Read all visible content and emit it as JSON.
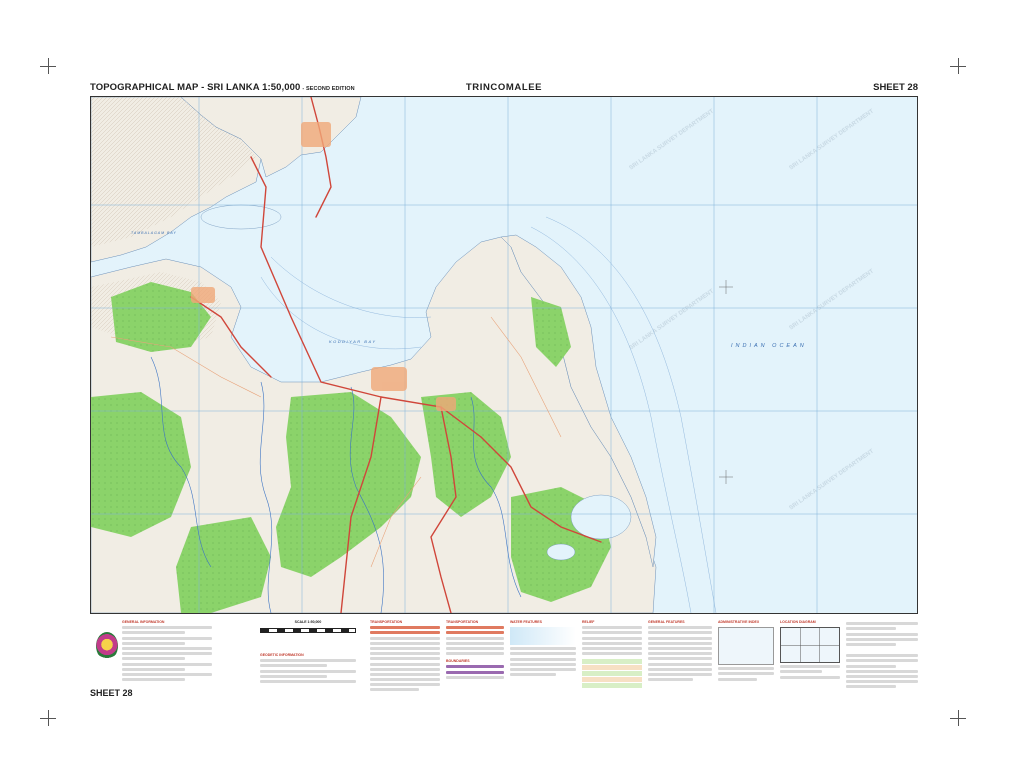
{
  "header": {
    "left_title": "TOPOGRAPHICAL MAP - SRI LANKA 1:50,000",
    "edition": "- SECOND EDITION",
    "center_title": "TRINCOMALEE",
    "right_title": "SHEET 28"
  },
  "map": {
    "sea_label": "INDIAN OCEAN",
    "bay_labels": [
      "KODDIYAR BAY",
      "TAMBALAGAM BAY"
    ],
    "colors": {
      "sea": "#e3f3fb",
      "land": "#f1ede4",
      "forest": "#8bd36a",
      "grid": "#7fb2d9",
      "road": "#d0463a",
      "river": "#3c74c4"
    }
  },
  "legend": {
    "sections": [
      "GENERAL INFORMATION",
      "GEODETIC INFORMATION",
      "TRANSPORTATION",
      "BOUNDARIES",
      "WATER FEATURES",
      "RELIEF",
      "GENERAL FEATURES",
      "ADMINISTRATIVE INDEX",
      "LOCATION DIAGRAM"
    ],
    "sheet_label": "SHEET 28",
    "scale_title": "SCALE 1:50,000"
  }
}
